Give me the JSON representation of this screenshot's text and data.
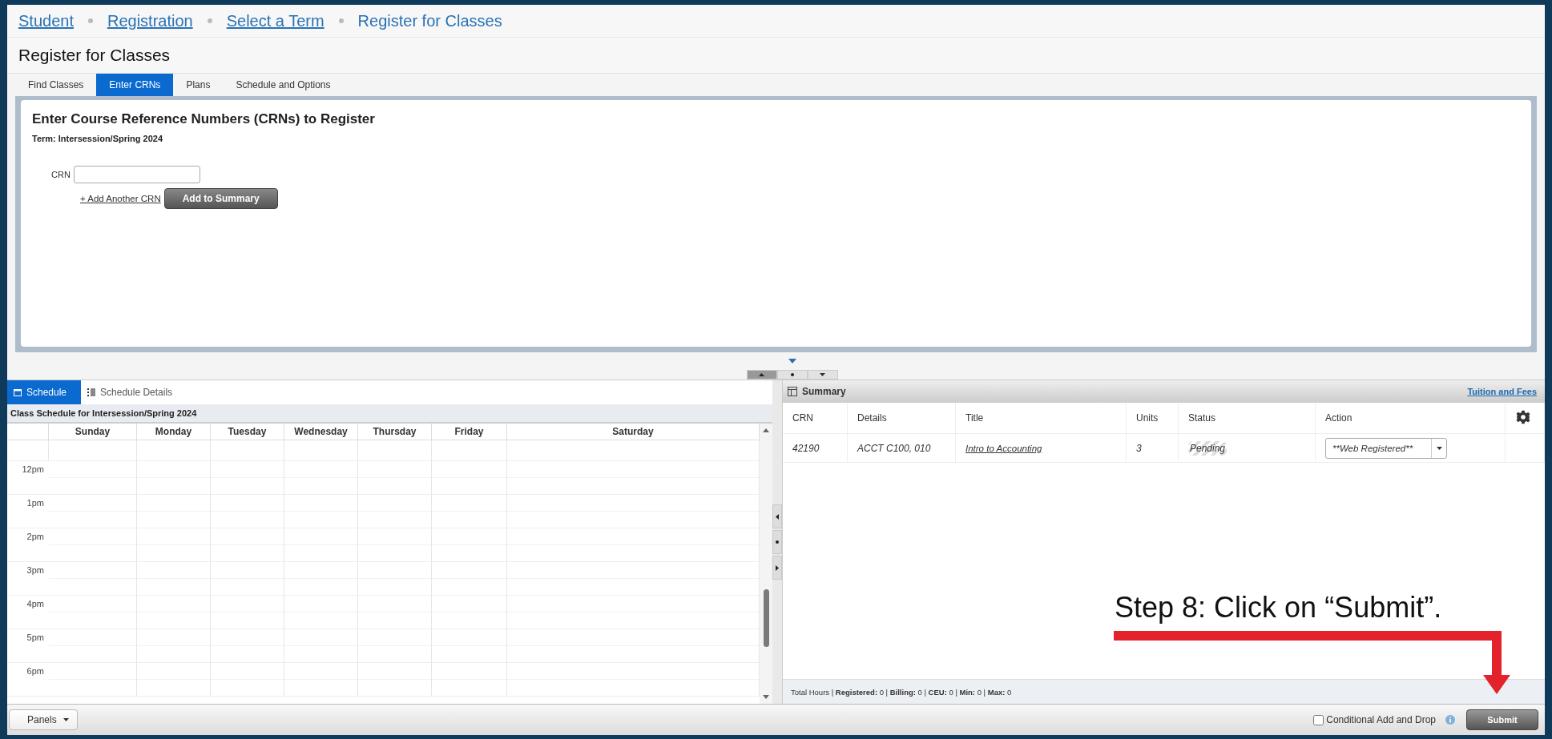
{
  "breadcrumb": [
    {
      "label": "Student",
      "kind": "link"
    },
    {
      "label": "Registration",
      "kind": "link"
    },
    {
      "label": "Select a Term",
      "kind": "link"
    },
    {
      "label": "Register for Classes",
      "kind": "current"
    }
  ],
  "page_title": "Register for Classes",
  "tabs": [
    {
      "label": "Find Classes",
      "selected": false
    },
    {
      "label": "Enter CRNs",
      "selected": true
    },
    {
      "label": "Plans",
      "selected": false
    },
    {
      "label": "Schedule and Options",
      "selected": false
    }
  ],
  "crn_panel": {
    "heading": "Enter Course Reference Numbers (CRNs) to Register",
    "term": "Term: Intersession/Spring 2024",
    "crn_label": "CRN",
    "add_link": "+ Add Another CRN",
    "add_button": "Add to Summary"
  },
  "schedule": {
    "tabs": [
      {
        "label": "Schedule",
        "selected": true
      },
      {
        "label": "Schedule Details",
        "selected": false
      }
    ],
    "caption": "Class Schedule for Intersession/Spring 2024",
    "days": [
      "Sunday",
      "Monday",
      "Tuesday",
      "Wednesday",
      "Thursday",
      "Friday",
      "Saturday"
    ],
    "times": [
      "12pm",
      "1pm",
      "2pm",
      "3pm",
      "4pm",
      "5pm",
      "6pm"
    ]
  },
  "summary": {
    "title": "Summary",
    "link": "Tuition and Fees",
    "columns": [
      "CRN",
      "Details",
      "Title",
      "Units",
      "Status",
      "Action"
    ],
    "rows": [
      {
        "crn": "42190",
        "details": "ACCT C100, 010",
        "title": "Intro to Accounting",
        "units": "3",
        "status": "Pending",
        "action": "**Web Registered**"
      }
    ],
    "totals": "Total Hours | **Registered:** 0 | **Billing:** 0 | **CEU:** 0 | **Min:** 0 | **Max:** 0"
  },
  "footer": {
    "panels_button": "Panels",
    "conditional": {
      "label": "Conditional Add and Drop",
      "checked": false
    },
    "submit": "Submit"
  },
  "annotation": "Step 8: Click on “Submit”."
}
